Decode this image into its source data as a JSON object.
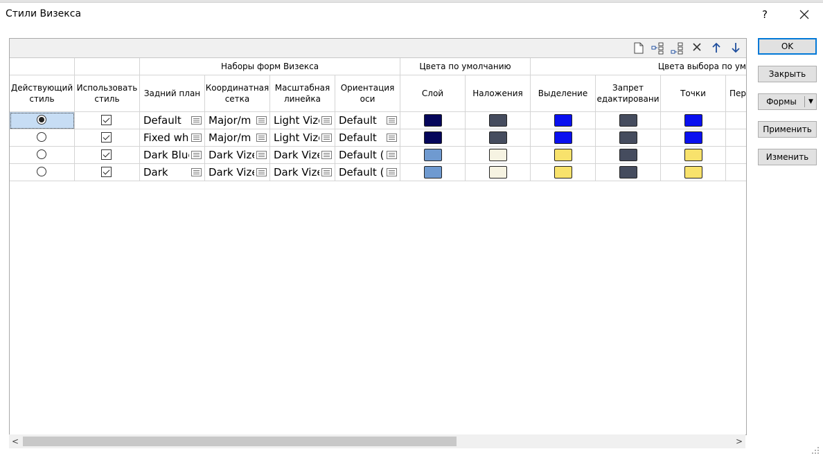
{
  "window": {
    "title": "Стили Визекса",
    "help": "?"
  },
  "toolbar": {
    "icons": [
      "new-document-icon",
      "insert-child-icon",
      "insert-sibling-icon",
      "delete-icon",
      "move-up-icon",
      "move-down-icon"
    ]
  },
  "groups": {
    "shapes": "Наборы форм Визекса",
    "defaults": "Цвета по умолчанию",
    "selection": "Цвета выбора по ум"
  },
  "columns": {
    "active": [
      "Действующий",
      "стиль"
    ],
    "use": [
      "Использовать",
      "стиль"
    ],
    "background": [
      "Задний план"
    ],
    "grid": [
      "Координатная",
      "сетка"
    ],
    "scale": [
      "Масштабная",
      "линейка"
    ],
    "axis": [
      "Ориентация",
      "оси"
    ],
    "layer": [
      "Слой"
    ],
    "overlays": [
      "Наложения"
    ],
    "highlight": [
      "Выделение"
    ],
    "locked": [
      "Запрет",
      "едактировани"
    ],
    "points": [
      "Точки"
    ],
    "extra": [
      "Пер"
    ]
  },
  "rows": [
    {
      "active": true,
      "use": true,
      "background": "Default",
      "grid": "Major/m",
      "scale": "Light Vize",
      "axis": "Default",
      "layer": "#05065a",
      "overlays": "#454c5e",
      "highlight": "#0a10ef",
      "locked": "#454c5e",
      "points": "#0a10ef"
    },
    {
      "active": false,
      "use": true,
      "background": "Fixed whi",
      "grid": "Major/m",
      "scale": "Light Vize",
      "axis": "Default",
      "layer": "#05065a",
      "overlays": "#454c5e",
      "highlight": "#0a10ef",
      "locked": "#454c5e",
      "points": "#0a10ef"
    },
    {
      "active": false,
      "use": true,
      "background": "Dark Blue",
      "grid": "Dark Vize",
      "scale": "Dark Vize",
      "axis": "Default (I",
      "layer": "#6f9ad0",
      "overlays": "#f6f3e2",
      "highlight": "#f8e26c",
      "locked": "#454c5e",
      "points": "#f8e26c"
    },
    {
      "active": false,
      "use": true,
      "background": "Dark",
      "grid": "Dark Vize",
      "scale": "Dark Vize",
      "axis": "Default (I",
      "layer": "#6f9ad0",
      "overlays": "#f6f3e2",
      "highlight": "#f8e26c",
      "locked": "#454c5e",
      "points": "#f8e26c"
    }
  ],
  "buttons": {
    "ok": "OK",
    "close": "Закрыть",
    "forms": "Формы",
    "apply": "Применить",
    "edit": "Изменить"
  },
  "colors": {
    "accent": "#0078d7",
    "selection_bg": "#c7ddf4"
  }
}
